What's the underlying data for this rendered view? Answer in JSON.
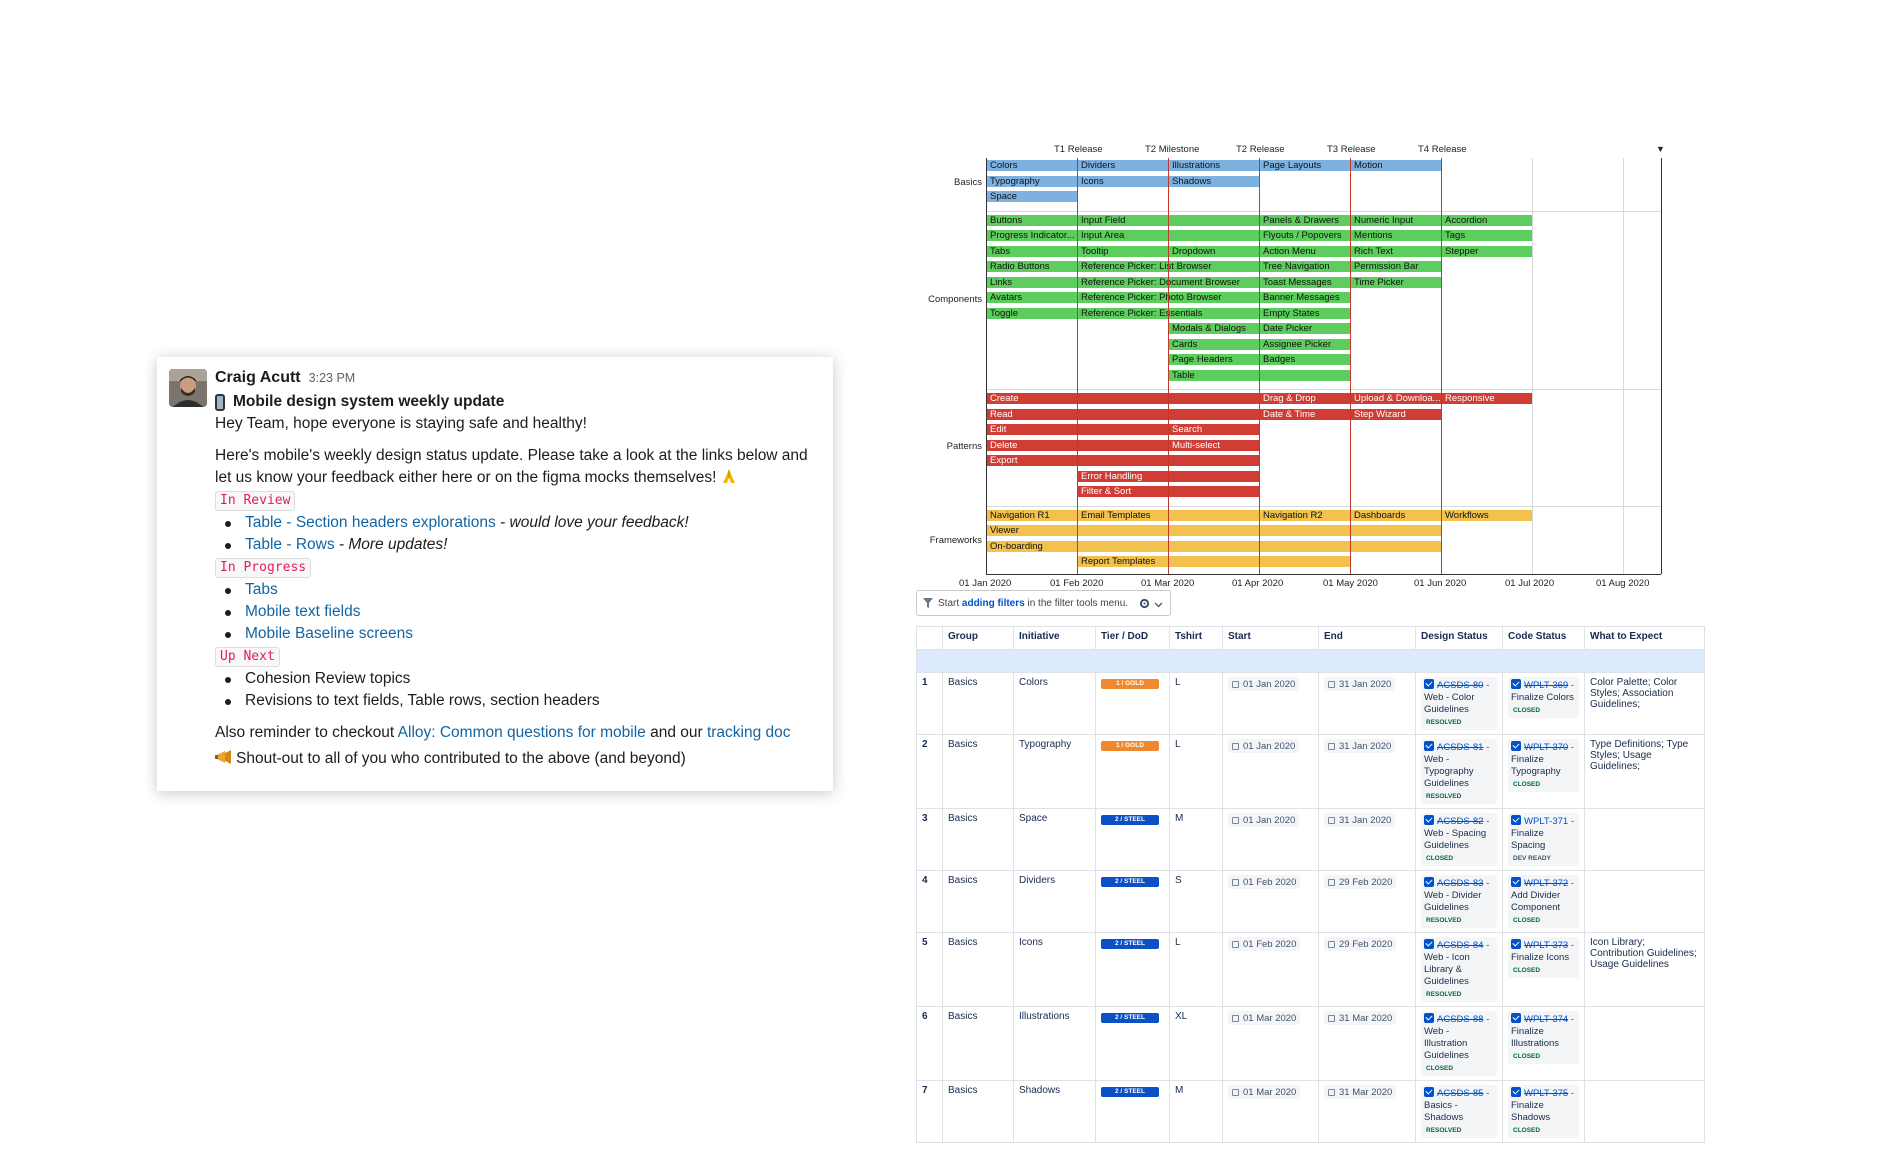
{
  "slack": {
    "author": "Craig Acutt",
    "time": "3:23 PM",
    "title": "Mobile design system weekly update",
    "greeting": "Hey Team, hope everyone is staying safe and healthy!",
    "intro": "Here's mobile's weekly design status update. Please take a look at the links below and let us know your feedback either here or on the figma mocks themselves!",
    "sections": [
      {
        "tag": "In Review",
        "items": [
          {
            "link": "Table - Section headers explorations",
            "note": " - would love your feedback!"
          },
          {
            "link": "Table - Rows",
            "note": " - More updates!"
          }
        ]
      },
      {
        "tag": "In Progress",
        "items": [
          {
            "link": "Tabs",
            "note": ""
          },
          {
            "link": "Mobile text fields",
            "note": ""
          },
          {
            "link": "Mobile Baseline screens",
            "note": ""
          }
        ]
      },
      {
        "tag": "Up Next",
        "items": [
          {
            "text": "Cohesion Review topics"
          },
          {
            "text": "Revisions to text fields, Table rows, section headers"
          }
        ]
      }
    ],
    "reminder_prefix": "Also reminder to checkout ",
    "reminder_link1": "Alloy: Common questions for mobile",
    "reminder_mid": " and our ",
    "reminder_link2": "tracking doc",
    "shoutout": "Shout-out to all of you who contributed to the above (and beyond)"
  },
  "gantt": {
    "colors": {
      "Basics": "#7db2e0",
      "Components": "#5dce5d",
      "Patterns": "#cf3d34",
      "Frameworks": "#f2c14e"
    },
    "x_ticks": [
      "01 Jan 2020",
      "01 Feb 2020",
      "01 Mar 2020",
      "01 Apr 2020",
      "01 May 2020",
      "01 Jun 2020",
      "01 Jul 2020",
      "01 Aug 2020"
    ],
    "milestones": [
      {
        "label": "T1 Release",
        "month": 1
      },
      {
        "label": "T2 Milestone",
        "month": 2
      },
      {
        "label": "T2 Release",
        "month": 3
      },
      {
        "label": "T3 Release",
        "month": 4
      },
      {
        "label": "T4 Release",
        "month": 5
      }
    ],
    "groups": [
      {
        "name": "Basics",
        "rows": 3
      },
      {
        "name": "Components",
        "rows": 11
      },
      {
        "name": "Patterns",
        "rows": 7
      },
      {
        "name": "Frameworks",
        "rows": 4
      }
    ],
    "bars": [
      {
        "g": "Basics",
        "r": 0,
        "s": 0,
        "e": 1,
        "label": "Colors"
      },
      {
        "g": "Basics",
        "r": 1,
        "s": 0,
        "e": 1,
        "label": "Typography"
      },
      {
        "g": "Basics",
        "r": 2,
        "s": 0,
        "e": 1,
        "label": "Space"
      },
      {
        "g": "Basics",
        "r": 0,
        "s": 1,
        "e": 2,
        "label": "Dividers"
      },
      {
        "g": "Basics",
        "r": 1,
        "s": 1,
        "e": 2,
        "label": "Icons"
      },
      {
        "g": "Basics",
        "r": 0,
        "s": 2,
        "e": 3,
        "label": "Illustrations"
      },
      {
        "g": "Basics",
        "r": 1,
        "s": 2,
        "e": 3,
        "label": "Shadows"
      },
      {
        "g": "Basics",
        "r": 0,
        "s": 3,
        "e": 4,
        "label": "Page Layouts"
      },
      {
        "g": "Basics",
        "r": 0,
        "s": 4,
        "e": 5,
        "label": "Motion"
      },
      {
        "g": "Components",
        "r": 0,
        "s": 0,
        "e": 1,
        "label": "Buttons"
      },
      {
        "g": "Components",
        "r": 1,
        "s": 0,
        "e": 1,
        "label": "Progress Indicator..."
      },
      {
        "g": "Components",
        "r": 2,
        "s": 0,
        "e": 1,
        "label": "Tabs"
      },
      {
        "g": "Components",
        "r": 3,
        "s": 0,
        "e": 1,
        "label": "Radio Buttons"
      },
      {
        "g": "Components",
        "r": 4,
        "s": 0,
        "e": 1,
        "label": "Links"
      },
      {
        "g": "Components",
        "r": 5,
        "s": 0,
        "e": 1,
        "label": "Avatars"
      },
      {
        "g": "Components",
        "r": 6,
        "s": 0,
        "e": 1,
        "label": "Toggle"
      },
      {
        "g": "Components",
        "r": 0,
        "s": 1,
        "e": 3,
        "label": "Input Field"
      },
      {
        "g": "Components",
        "r": 1,
        "s": 1,
        "e": 3,
        "label": "Input Area"
      },
      {
        "g": "Components",
        "r": 2,
        "s": 1,
        "e": 2,
        "label": "Tooltip"
      },
      {
        "g": "Components",
        "r": 3,
        "s": 1,
        "e": 3,
        "label": "Reference Picker: List Browser"
      },
      {
        "g": "Components",
        "r": 4,
        "s": 1,
        "e": 3,
        "label": "Reference Picker: Document Browser"
      },
      {
        "g": "Components",
        "r": 5,
        "s": 1,
        "e": 3,
        "label": "Reference Picker: Photo Browser"
      },
      {
        "g": "Components",
        "r": 6,
        "s": 1,
        "e": 3,
        "label": "Reference Picker: Essentials"
      },
      {
        "g": "Components",
        "r": 2,
        "s": 2,
        "e": 3,
        "label": "Dropdown"
      },
      {
        "g": "Components",
        "r": 7,
        "s": 2,
        "e": 3,
        "label": "Modals & Dialogs"
      },
      {
        "g": "Components",
        "r": 8,
        "s": 2,
        "e": 3,
        "label": "Cards"
      },
      {
        "g": "Components",
        "r": 9,
        "s": 2,
        "e": 3,
        "label": "Page Headers"
      },
      {
        "g": "Components",
        "r": 10,
        "s": 2,
        "e": 3,
        "label": "Table"
      },
      {
        "g": "Components",
        "r": 0,
        "s": 3,
        "e": 4,
        "label": "Panels & Drawers"
      },
      {
        "g": "Components",
        "r": 1,
        "s": 3,
        "e": 4,
        "label": "Flyouts / Popovers"
      },
      {
        "g": "Components",
        "r": 2,
        "s": 3,
        "e": 4,
        "label": "Action Menu"
      },
      {
        "g": "Components",
        "r": 3,
        "s": 3,
        "e": 4,
        "label": "Tree Navigation"
      },
      {
        "g": "Components",
        "r": 4,
        "s": 3,
        "e": 4,
        "label": "Toast Messages"
      },
      {
        "g": "Components",
        "r": 5,
        "s": 3,
        "e": 4,
        "label": "Banner Messages"
      },
      {
        "g": "Components",
        "r": 6,
        "s": 3,
        "e": 4,
        "label": "Empty States"
      },
      {
        "g": "Components",
        "r": 7,
        "s": 3,
        "e": 4,
        "label": "Date Picker"
      },
      {
        "g": "Components",
        "r": 8,
        "s": 3,
        "e": 4,
        "label": "Assignee Picker"
      },
      {
        "g": "Components",
        "r": 9,
        "s": 3,
        "e": 4,
        "label": "Badges"
      },
      {
        "g": "Components",
        "r": 10,
        "s": 3,
        "e": 4,
        "label": ""
      },
      {
        "g": "Components",
        "r": 0,
        "s": 4,
        "e": 5,
        "label": "Numeric Input"
      },
      {
        "g": "Components",
        "r": 1,
        "s": 4,
        "e": 5,
        "label": "Mentions"
      },
      {
        "g": "Components",
        "r": 2,
        "s": 4,
        "e": 5,
        "label": "Rich Text"
      },
      {
        "g": "Components",
        "r": 3,
        "s": 4,
        "e": 5,
        "label": "Permission Bar"
      },
      {
        "g": "Components",
        "r": 4,
        "s": 4,
        "e": 5,
        "label": "Time Picker"
      },
      {
        "g": "Components",
        "r": 0,
        "s": 5,
        "e": 6,
        "label": "Accordion"
      },
      {
        "g": "Components",
        "r": 1,
        "s": 5,
        "e": 6,
        "label": "Tags"
      },
      {
        "g": "Components",
        "r": 2,
        "s": 5,
        "e": 6,
        "label": "Stepper"
      },
      {
        "g": "Patterns",
        "r": 0,
        "s": 0,
        "e": 3,
        "label": "Create"
      },
      {
        "g": "Patterns",
        "r": 1,
        "s": 0,
        "e": 3,
        "label": "Read"
      },
      {
        "g": "Patterns",
        "r": 2,
        "s": 0,
        "e": 2,
        "label": "Edit"
      },
      {
        "g": "Patterns",
        "r": 3,
        "s": 0,
        "e": 2,
        "label": "Delete"
      },
      {
        "g": "Patterns",
        "r": 4,
        "s": 0,
        "e": 3,
        "label": "Export"
      },
      {
        "g": "Patterns",
        "r": 5,
        "s": 1,
        "e": 3,
        "label": "Error Handling"
      },
      {
        "g": "Patterns",
        "r": 6,
        "s": 1,
        "e": 3,
        "label": "Filter & Sort"
      },
      {
        "g": "Patterns",
        "r": 2,
        "s": 2,
        "e": 3,
        "label": "Search"
      },
      {
        "g": "Patterns",
        "r": 3,
        "s": 2,
        "e": 3,
        "label": "Multi-select"
      },
      {
        "g": "Patterns",
        "r": 0,
        "s": 3,
        "e": 4,
        "label": "Drag & Drop"
      },
      {
        "g": "Patterns",
        "r": 1,
        "s": 3,
        "e": 4,
        "label": "Date & Time"
      },
      {
        "g": "Patterns",
        "r": 0,
        "s": 4,
        "e": 5,
        "label": "Upload & Downloa..."
      },
      {
        "g": "Patterns",
        "r": 1,
        "s": 4,
        "e": 5,
        "label": "Step Wizard"
      },
      {
        "g": "Patterns",
        "r": 0,
        "s": 5,
        "e": 6,
        "label": "Responsive"
      },
      {
        "g": "Frameworks",
        "r": 0,
        "s": 0,
        "e": 1,
        "label": "Navigation R1"
      },
      {
        "g": "Frameworks",
        "r": 1,
        "s": 0,
        "e": 5,
        "label": "Viewer"
      },
      {
        "g": "Frameworks",
        "r": 2,
        "s": 0,
        "e": 5,
        "label": "On-boarding"
      },
      {
        "g": "Frameworks",
        "r": 0,
        "s": 1,
        "e": 3,
        "label": "Email Templates"
      },
      {
        "g": "Frameworks",
        "r": 3,
        "s": 1,
        "e": 4,
        "label": "Report Templates"
      },
      {
        "g": "Frameworks",
        "r": 0,
        "s": 3,
        "e": 4,
        "label": "Navigation R2"
      },
      {
        "g": "Frameworks",
        "r": 0,
        "s": 4,
        "e": 5,
        "label": "Dashboards"
      },
      {
        "g": "Frameworks",
        "r": 0,
        "s": 5,
        "e": 6,
        "label": "Workflows"
      }
    ]
  },
  "filter": {
    "prefix": "Start ",
    "link": "adding filters",
    "suffix": " in the filter tools menu."
  },
  "table": {
    "headers": [
      "",
      "Group",
      "Initiative",
      "Tier / DoD",
      "Tshirt",
      "Start",
      "End",
      "Design Status",
      "Code Status",
      "What to Expect"
    ],
    "tier_colors": {
      "1 / GOLD": "#f0892d",
      "2 / STEEL": "#0b50c5"
    },
    "rows": [
      {
        "n": "1",
        "group": "Basics",
        "initiative": "Colors",
        "tier": "1 / GOLD",
        "tshirt": "L",
        "start": "01 Jan 2020",
        "end": "31 Jan 2020",
        "design": {
          "key": "ACSDS-80",
          "text": "Web - Color Guidelines",
          "status": "RESOLVED"
        },
        "code": {
          "key": "WPLT-369",
          "text": "Finalize Colors",
          "status": "CLOSED"
        },
        "expect": "Color Palette; Color Styles; Association Guidelines;"
      },
      {
        "n": "2",
        "group": "Basics",
        "initiative": "Typography",
        "tier": "1 / GOLD",
        "tshirt": "L",
        "start": "01 Jan 2020",
        "end": "31 Jan 2020",
        "design": {
          "key": "ACSDS-81",
          "text": "Web - Typography Guidelines",
          "status": "RESOLVED"
        },
        "code": {
          "key": "WPLT-370",
          "text": "Finalize Typography",
          "status": "CLOSED"
        },
        "expect": "Type Definitions; Type Styles; Usage Guidelines;"
      },
      {
        "n": "3",
        "group": "Basics",
        "initiative": "Space",
        "tier": "2 / STEEL",
        "tshirt": "M",
        "start": "01 Jan 2020",
        "end": "31 Jan 2020",
        "design": {
          "key": "ACSDS-82",
          "text": "Web - Spacing Guidelines",
          "status": "CLOSED"
        },
        "code": {
          "key": "WPLT-371",
          "text": "Finalize Spacing",
          "status": "DEV READY"
        },
        "expect": ""
      },
      {
        "n": "4",
        "group": "Basics",
        "initiative": "Dividers",
        "tier": "2 / STEEL",
        "tshirt": "S",
        "start": "01 Feb 2020",
        "end": "29 Feb 2020",
        "design": {
          "key": "ACSDS-83",
          "text": "Web - Divider Guidelines",
          "status": "RESOLVED"
        },
        "code": {
          "key": "WPLT-372",
          "text": "Add Divider Component",
          "status": "CLOSED"
        },
        "expect": ""
      },
      {
        "n": "5",
        "group": "Basics",
        "initiative": "Icons",
        "tier": "2 / STEEL",
        "tshirt": "L",
        "start": "01 Feb 2020",
        "end": "29 Feb 2020",
        "design": {
          "key": "ACSDS-84",
          "text": "Web - Icon Library & Guidelines",
          "status": "RESOLVED"
        },
        "code": {
          "key": "WPLT-373",
          "text": "Finalize Icons",
          "status": "CLOSED"
        },
        "expect": "Icon Library; Contribution Guidelines; Usage Guidelines"
      },
      {
        "n": "6",
        "group": "Basics",
        "initiative": "Illustrations",
        "tier": "2 / STEEL",
        "tshirt": "XL",
        "start": "01 Mar 2020",
        "end": "31 Mar 2020",
        "design": {
          "key": "ACSDS-88",
          "text": "Web - Illustration Guidelines",
          "status": "CLOSED"
        },
        "code": {
          "key": "WPLT-374",
          "text": "Finalize Illustrations",
          "status": "CLOSED"
        },
        "expect": ""
      },
      {
        "n": "7",
        "group": "Basics",
        "initiative": "Shadows",
        "tier": "2 / STEEL",
        "tshirt": "M",
        "start": "01 Mar 2020",
        "end": "31 Mar 2020",
        "design": {
          "key": "ACSDS-85",
          "text": "Basics - Shadows",
          "status": "RESOLVED"
        },
        "code": {
          "key": "WPLT-375",
          "text": "Finalize Shadows",
          "status": "CLOSED"
        },
        "expect": ""
      }
    ]
  }
}
